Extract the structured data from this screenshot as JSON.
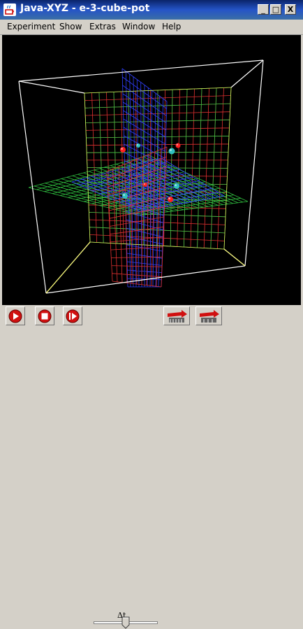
{
  "window": {
    "title": "Java-XYZ - e-3-cube-pot",
    "controls": {
      "minimize": "_",
      "maximize": "□",
      "close": "X"
    }
  },
  "menu": {
    "items": [
      {
        "label": "Experiment"
      },
      {
        "label": "Show"
      },
      {
        "label": "Extras"
      },
      {
        "label": "Window"
      },
      {
        "label": "Help"
      }
    ]
  },
  "toolbar": {
    "play_icon": "play-icon",
    "stop_icon": "stop-icon",
    "step_icon": "step-forward-icon",
    "dt_label": "Δt",
    "dt_slider_fraction": 0.5,
    "fast_forward_icon": "fast-forward-icon",
    "reset_icon": "reset-icon"
  },
  "colors": {
    "canvas_background": "#000000",
    "grid_red": "#e03030",
    "grid_green": "#30c040",
    "grid_blue": "#3040ff",
    "cube_frame": "#ffffff",
    "cube_axis": "#ffff60",
    "charge_positive": "#ff2020",
    "charge_negative": "#30c0c0"
  }
}
